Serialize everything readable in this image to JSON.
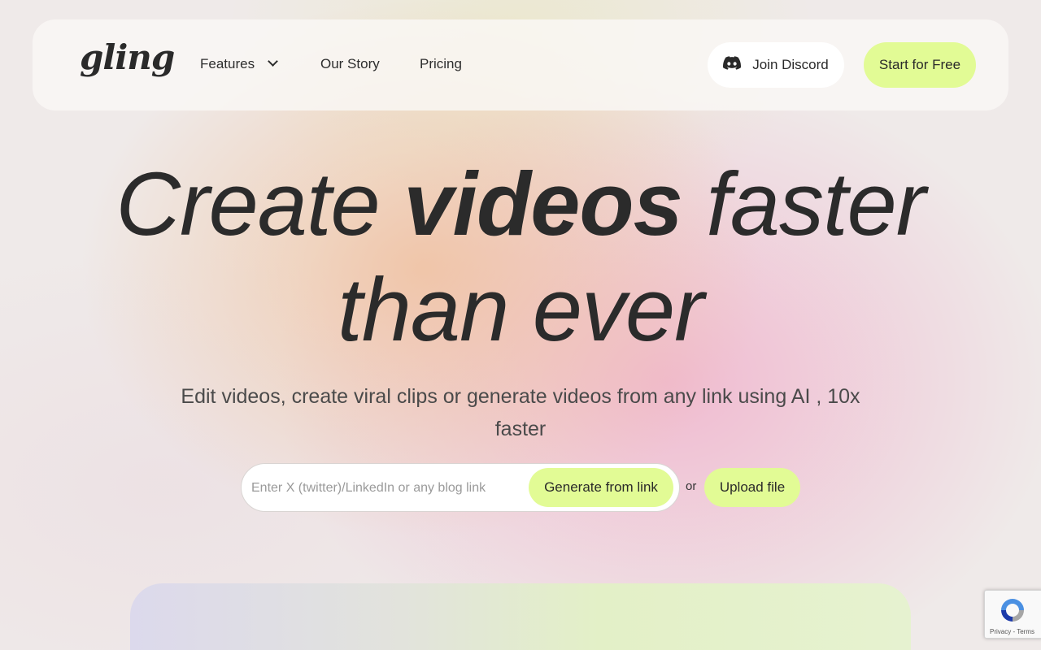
{
  "brand": {
    "name": "gling"
  },
  "nav": {
    "items": [
      {
        "label": "Features"
      },
      {
        "label": "Our Story"
      },
      {
        "label": "Pricing"
      }
    ],
    "discord_label": "Join Discord",
    "cta_label": "Start for Free"
  },
  "hero": {
    "headline_part1": "Create",
    "headline_bold": "videos",
    "headline_part2": "faster",
    "headline_line2": "than ever",
    "subtitle": "Edit videos, create viral clips or generate videos from any link using AI , 10x faster"
  },
  "link_form": {
    "placeholder": "Enter X (twitter)/LinkedIn or any blog link",
    "value": "",
    "generate_label": "Generate from link"
  },
  "or_text": "or",
  "upload_label": "Upload file",
  "recaptcha": {
    "privacy": "Privacy",
    "terms": "Terms"
  },
  "colors": {
    "accent": "#e2fb95",
    "text": "#2b2b2b",
    "nav_bg": "#faf8f5"
  },
  "icons": {
    "discord": "discord-icon",
    "features_dropdown": "chevron-down-icon",
    "recaptcha": "recaptcha-icon"
  }
}
